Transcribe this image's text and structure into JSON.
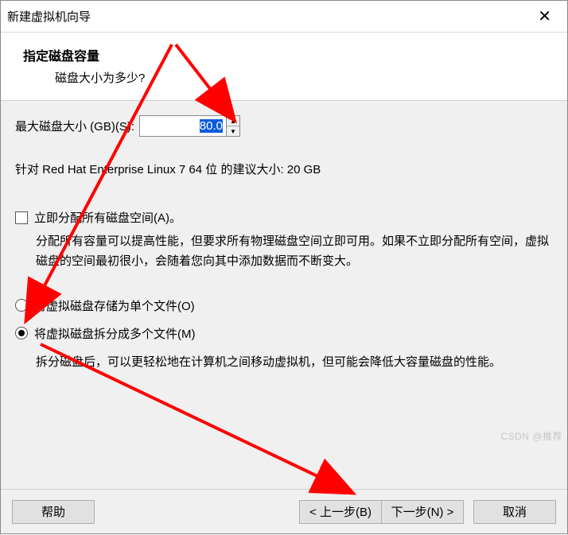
{
  "window": {
    "title": "新建虚拟机向导"
  },
  "header": {
    "title": "指定磁盘容量",
    "subtitle": "磁盘大小为多少?"
  },
  "disk": {
    "size_label": "最大磁盘大小 (GB)(S):",
    "size_value": "80.0",
    "recommend": "针对 Red Hat Enterprise Linux 7 64 位 的建议大小: 20 GB"
  },
  "allocate": {
    "label": "立即分配所有磁盘空间(A)。",
    "checked": false,
    "desc": "分配所有容量可以提高性能，但要求所有物理磁盘空间立即可用。如果不立即分配所有空间，虚拟磁盘的空间最初很小，会随着您向其中添加数据而不断变大。"
  },
  "store": {
    "single_label": "将虚拟磁盘存储为单个文件(O)",
    "split_label": "将虚拟磁盘拆分成多个文件(M)",
    "selected": "split",
    "split_desc": "拆分磁盘后，可以更轻松地在计算机之间移动虚拟机，但可能会降低大容量磁盘的性能。"
  },
  "buttons": {
    "help": "帮助",
    "back": "< 上一步(B)",
    "next": "下一步(N) >",
    "cancel": "取消"
  },
  "watermark": "CSDN @推荐"
}
